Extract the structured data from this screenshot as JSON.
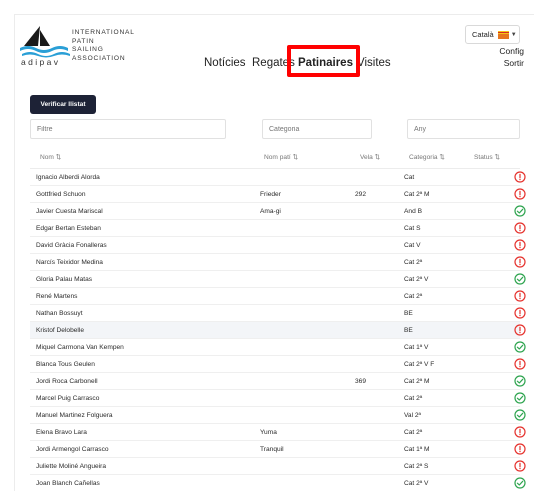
{
  "header": {
    "logo_org_lines": [
      "INTERNATIONAL",
      "PATIN",
      "SAILING",
      "ASSOCIATION"
    ],
    "logo_word": "adipav",
    "nav": [
      {
        "label": "Notícies",
        "active": false
      },
      {
        "label": "Regates",
        "active": false
      },
      {
        "label": "Patinaires",
        "active": true
      },
      {
        "label": "Visites",
        "active": false
      }
    ],
    "language": "Català",
    "config_label": "Config",
    "logout_label": "Sortir"
  },
  "toolbar": {
    "verify_label": "Verificar llistat"
  },
  "filters": {
    "name_placeholder": "Filtre",
    "category_placeholder": "Categoria",
    "year_placeholder": "Any"
  },
  "table": {
    "headers": {
      "name": "Nom ⇅",
      "pati": "Nom patí ⇅",
      "vela": "Vela ⇅",
      "category": "Categoria ⇅",
      "status": "Status ⇅"
    },
    "rows": [
      {
        "name": "Ignacio Alberdi Alorda",
        "pati": "",
        "vela": "",
        "category": "Cat",
        "status": "error"
      },
      {
        "name": "Gottfried Schuon",
        "pati": "Frieder",
        "vela": "292",
        "category": "Cat 2ª M",
        "status": "error"
      },
      {
        "name": "Javier Cuesta Mariscal",
        "pati": "Ama-gi",
        "vela": "",
        "category": "And B",
        "status": "ok"
      },
      {
        "name": "Edgar Bertan Esteban",
        "pati": "",
        "vela": "",
        "category": "Cat S",
        "status": "error"
      },
      {
        "name": "David Gràcia Fonalleras",
        "pati": "",
        "vela": "",
        "category": "Cat V",
        "status": "error"
      },
      {
        "name": "Narcís Teixidor Medina",
        "pati": "",
        "vela": "",
        "category": "Cat 2ª",
        "status": "error"
      },
      {
        "name": "Gloria Palau Matas",
        "pati": "",
        "vela": "",
        "category": "Cat 2ª V",
        "status": "ok"
      },
      {
        "name": "René Martens",
        "pati": "",
        "vela": "",
        "category": "Cat 2ª",
        "status": "error"
      },
      {
        "name": "Nathan Bossuyt",
        "pati": "",
        "vela": "",
        "category": "BE",
        "status": "error"
      },
      {
        "name": "Kristof Delobelle",
        "pati": "",
        "vela": "",
        "category": "BE",
        "status": "error"
      },
      {
        "name": "Miquel Carmona Van Kempen",
        "pati": "",
        "vela": "",
        "category": "Cat 1ª V",
        "status": "ok"
      },
      {
        "name": "Blanca Tous Geulen",
        "pati": "",
        "vela": "",
        "category": "Cat 2ª V F",
        "status": "error"
      },
      {
        "name": "Jordi Roca Carbonell",
        "pati": "",
        "vela": "369",
        "category": "Cat 2ª M",
        "status": "ok"
      },
      {
        "name": "Marcel Puig Carrasco",
        "pati": "",
        "vela": "",
        "category": "Cat 2ª",
        "status": "ok"
      },
      {
        "name": "Manuel Martinez Folguera",
        "pati": "",
        "vela": "",
        "category": "Val 2ª",
        "status": "ok"
      },
      {
        "name": "Elena Bravo Lara",
        "pati": "Yuma",
        "vela": "",
        "category": "Cat 2ª",
        "status": "error"
      },
      {
        "name": "Jordi Armengol Carrasco",
        "pati": "Tranquil",
        "vela": "",
        "category": "Cat 1ª M",
        "status": "error"
      },
      {
        "name": "Juliette Moliné Angueira",
        "pati": "",
        "vela": "",
        "category": "Cat 2ª S",
        "status": "error"
      },
      {
        "name": "Joan Blanch Cañellas",
        "pati": "",
        "vela": "",
        "category": "Cat 2ª V",
        "status": "ok"
      }
    ]
  },
  "colors": {
    "accent_dark": "#1d2236",
    "status_ok": "#2ea44f",
    "status_error": "#e5322d",
    "highlight_box": "#ff0000"
  },
  "icons": {
    "status_ok": "check-circle-icon",
    "status_error": "exclamation-circle-icon"
  }
}
